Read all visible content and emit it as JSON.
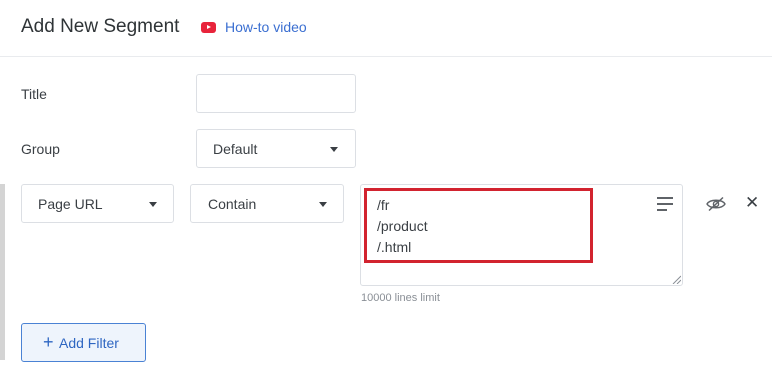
{
  "header": {
    "title": "Add New Segment",
    "howto_label": "How-to video",
    "howto_icon": "youtube-icon"
  },
  "form": {
    "title_label": "Title",
    "title_value": "",
    "group_label": "Group",
    "group_value": "Default"
  },
  "filter": {
    "field_value": "Page URL",
    "operator_value": "Contain",
    "values": [
      "/fr",
      "/product",
      "/.html"
    ],
    "limit_note": "10000 lines limit",
    "highlight_color": "#d2232f"
  },
  "actions": {
    "add_filter_plus": "+",
    "add_filter_label": "Add Filter"
  },
  "colors": {
    "accent": "#3b6fd1",
    "youtube": "#e8243b"
  }
}
